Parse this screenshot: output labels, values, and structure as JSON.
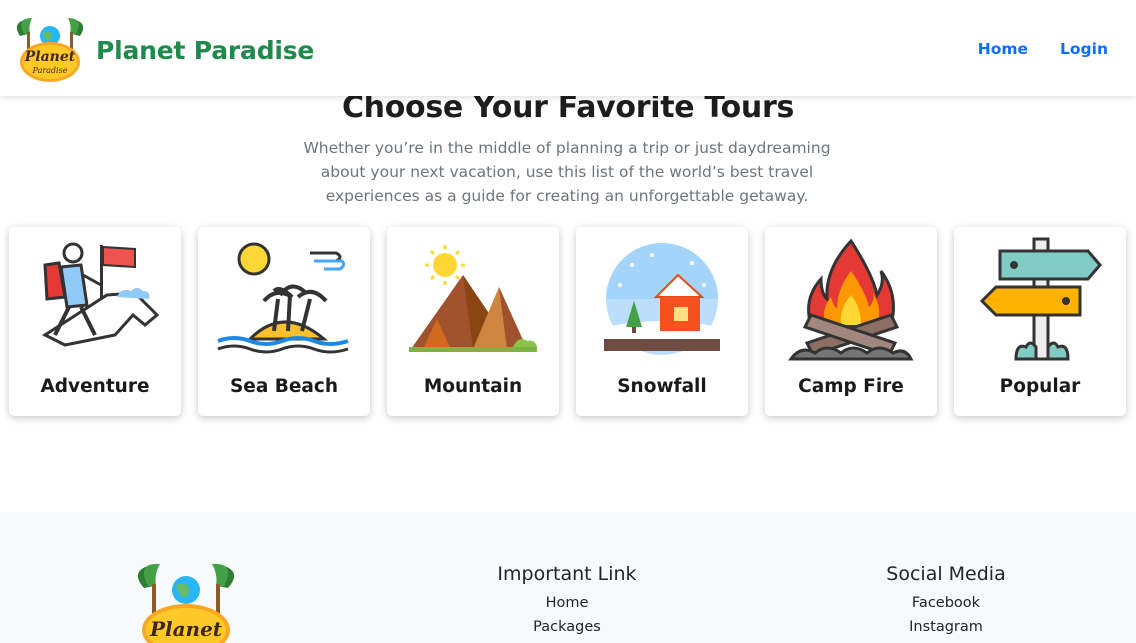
{
  "brand": {
    "name": "Planet Paradise",
    "logo_text_top": "Planet",
    "logo_text_bottom": "Paradise"
  },
  "nav": {
    "home": "Home",
    "login": "Login"
  },
  "hero": {
    "title": "Choose Your Favorite Tours",
    "subtitle": "Whether you’re in the middle of planning a trip or just daydreaming about your next vacation, use this list of the world’s best travel experiences as a guide for creating an unforgettable getaway."
  },
  "cards": [
    {
      "label": "Adventure",
      "icon": "hiker-flag-icon"
    },
    {
      "label": "Sea Beach",
      "icon": "island-palm-icon"
    },
    {
      "label": "Mountain",
      "icon": "mountain-sun-icon"
    },
    {
      "label": "Snowfall",
      "icon": "snow-globe-icon"
    },
    {
      "label": "Camp Fire",
      "icon": "campfire-icon"
    },
    {
      "label": "Popular",
      "icon": "signpost-icon"
    }
  ],
  "footer": {
    "links": {
      "heading": "Important Link",
      "items": [
        "Home",
        "Packages"
      ]
    },
    "social": {
      "heading": "Social Media",
      "items": [
        "Facebook",
        "Instagram"
      ]
    }
  },
  "colors": {
    "brand_green": "#1f8a4c",
    "nav_blue": "#0d6efd",
    "footer_bg": "#f8f9fa"
  }
}
